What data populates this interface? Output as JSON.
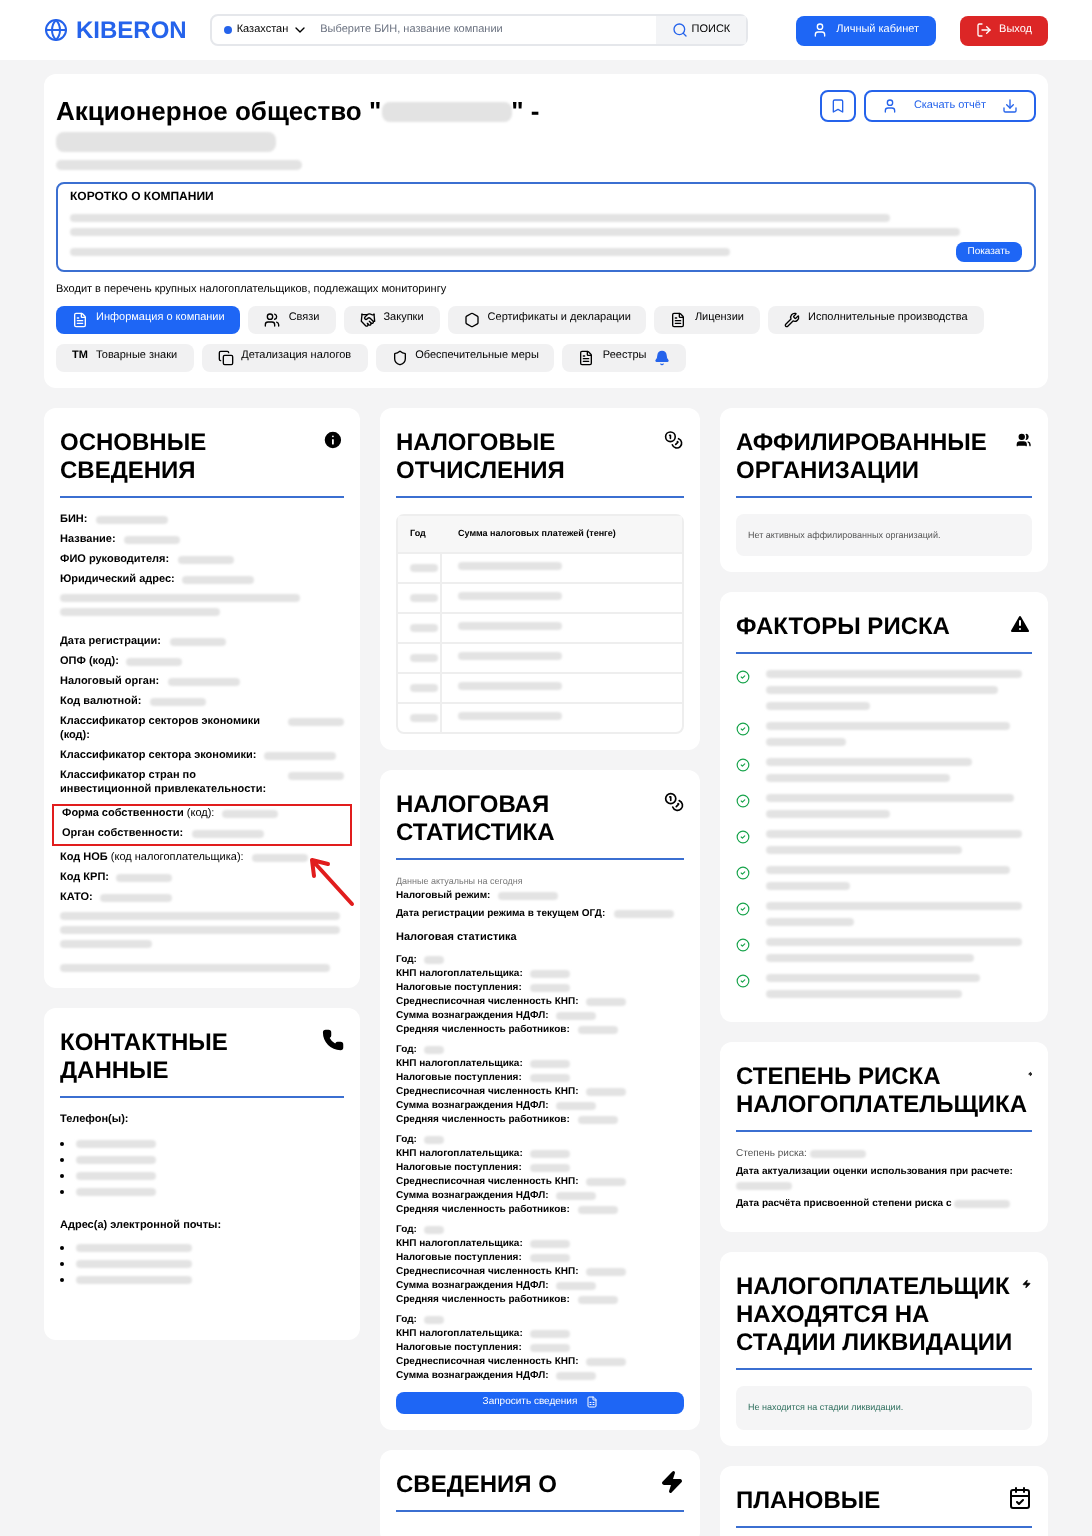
{
  "header": {
    "logo": "KIBERON",
    "country": "Казахстан",
    "search_placeholder": "Выберите БИН, название компании",
    "search_button": "ПОИСК",
    "cabinet_button": "Личный кабинет",
    "logout_button": "Выход"
  },
  "company": {
    "title_start": "Акционерное общество \"",
    "title_end": "\" -",
    "download_button": "Скачать отчёт",
    "about_title": "КОРОТКО О КОМПАНИИ",
    "show_button": "Показать",
    "note": "Входит в перечень крупных налогоплательщиков, подлежащих мониторингу",
    "tabs": [
      {
        "label": "Информация о компании",
        "selected": true
      },
      {
        "label": "Связи",
        "selected": false
      },
      {
        "label": "Закупки",
        "selected": false
      },
      {
        "label": "Сертификаты и декларации",
        "selected": false
      },
      {
        "label": "Лицензии",
        "selected": false
      },
      {
        "label": "Исполнительные производства",
        "selected": false
      },
      {
        "label": "Товарные знаки",
        "mark": "TM",
        "selected": false
      },
      {
        "label": "Детализация налогов",
        "selected": false
      },
      {
        "label": "Обеспечительные меры",
        "selected": false
      },
      {
        "label": "Реестры",
        "selected": false
      }
    ]
  },
  "basic": {
    "title": "ОСНОВНЫЕ СВЕДЕНИЯ",
    "fields": [
      {
        "label": "БИН:",
        "highlighted": false
      },
      {
        "label": "Название:",
        "highlighted": false
      },
      {
        "label": "ФИО руководителя:",
        "highlighted": false
      },
      {
        "label": "Юридический адрес:",
        "highlighted": false
      },
      {
        "label": "Дата регистрации:",
        "highlighted": false
      },
      {
        "label": "ОПФ (код):",
        "highlighted": false
      },
      {
        "label": "Налоговый орган:",
        "highlighted": false
      },
      {
        "label": "Код валютной:",
        "highlighted": false
      },
      {
        "label": "Классификатор секторов экономики (код):",
        "highlighted": false
      },
      {
        "label": "Классификатор сектора экономики:",
        "highlighted": false
      },
      {
        "label": "Классификатор стран по инвестиционной привлекательности:",
        "highlighted": false
      },
      {
        "label": "Форма собственности",
        "note": "(код):",
        "highlighted": true
      },
      {
        "label": "Орган собственности:",
        "highlighted": true
      },
      {
        "label": "Код НОБ",
        "note": "(код налогоплательщика):",
        "highlighted": false
      },
      {
        "label": "Код КРП:",
        "highlighted": false
      },
      {
        "label": "КАТО:",
        "highlighted": false
      }
    ]
  },
  "contacts": {
    "title": "КОНТАКТНЫЕ ДАННЫЕ",
    "phones_label": "Телефон(ы):",
    "emails_label": "Адрес(а) электронной почты:"
  },
  "tax_payments": {
    "title": "НАЛОГОВЫЕ ОТЧИСЛЕНИЯ",
    "columns": [
      "Год",
      "Сумма налоговых платежей (тенге)"
    ]
  },
  "tax_stats": {
    "title": "НАЛОГОВАЯ СТАТИСТИКА",
    "note": "Данные актуальны на сегодня",
    "fields": [
      "Налоговый режим:",
      "Дата регистрации режима в текущем ОГД:"
    ],
    "subtitle": "Налоговая статистика",
    "groups": [
      [
        "Год:",
        "КНП налогоплательщика:",
        "Налоговые поступления:",
        "Среднесписочная численность КНП:",
        "Сумма вознаграждения НДФЛ:",
        "Средняя численность работников:"
      ],
      [
        "Год:",
        "КНП налогоплательщика:",
        "Налоговые поступления:",
        "Среднесписочная численность КНП:",
        "Сумма вознаграждения НДФЛ:",
        "Средняя численность работников:"
      ],
      [
        "Год:",
        "КНП налогоплательщика:",
        "Налоговые поступления:",
        "Среднесписочная численность КНП:",
        "Сумма вознаграждения НДФЛ:",
        "Средняя численность работников:"
      ],
      [
        "Год:",
        "КНП налогоплательщика:",
        "Налоговые поступления:",
        "Среднесписочная численность КНП:",
        "Сумма вознаграждения НДФЛ:",
        "Средняя численность работников:"
      ],
      [
        "Год:",
        "КНП налогоплательщика:",
        "Налоговые поступления:",
        "Среднесписочная численность КНП:",
        "Сумма вознаграждения НДФЛ:"
      ]
    ],
    "button": "Запросить сведения"
  },
  "affiliates": {
    "title": "АФФИЛИРОВАННЫЕ ОРГАНИЗАЦИИ",
    "message": "Нет активных аффилированных организаций."
  },
  "risk_factors": {
    "title": "ФАКТОРЫ РИСКА"
  },
  "risk_level": {
    "title": "СТЕПЕНЬ РИСКА НАЛОГОПЛАТЕЛЬЩИКА",
    "fields": [
      "Степень риска:",
      "Дата актуализации оценки использования при расчете:",
      "Дата расчёта присвоенной степени риска с"
    ]
  },
  "liquidation": {
    "title": "НАЛОГОПЛАТЕЛЬЩИК НАХОДЯТСЯ НА СТАДИИ ЛИКВИДАЦИИ",
    "message": "Не находится на стадии ликвидации."
  },
  "bottom_cards": [
    {
      "title": "СВЕДЕНИЯ О"
    },
    {
      "title": "ПЛАНОВЫЕ"
    }
  ]
}
